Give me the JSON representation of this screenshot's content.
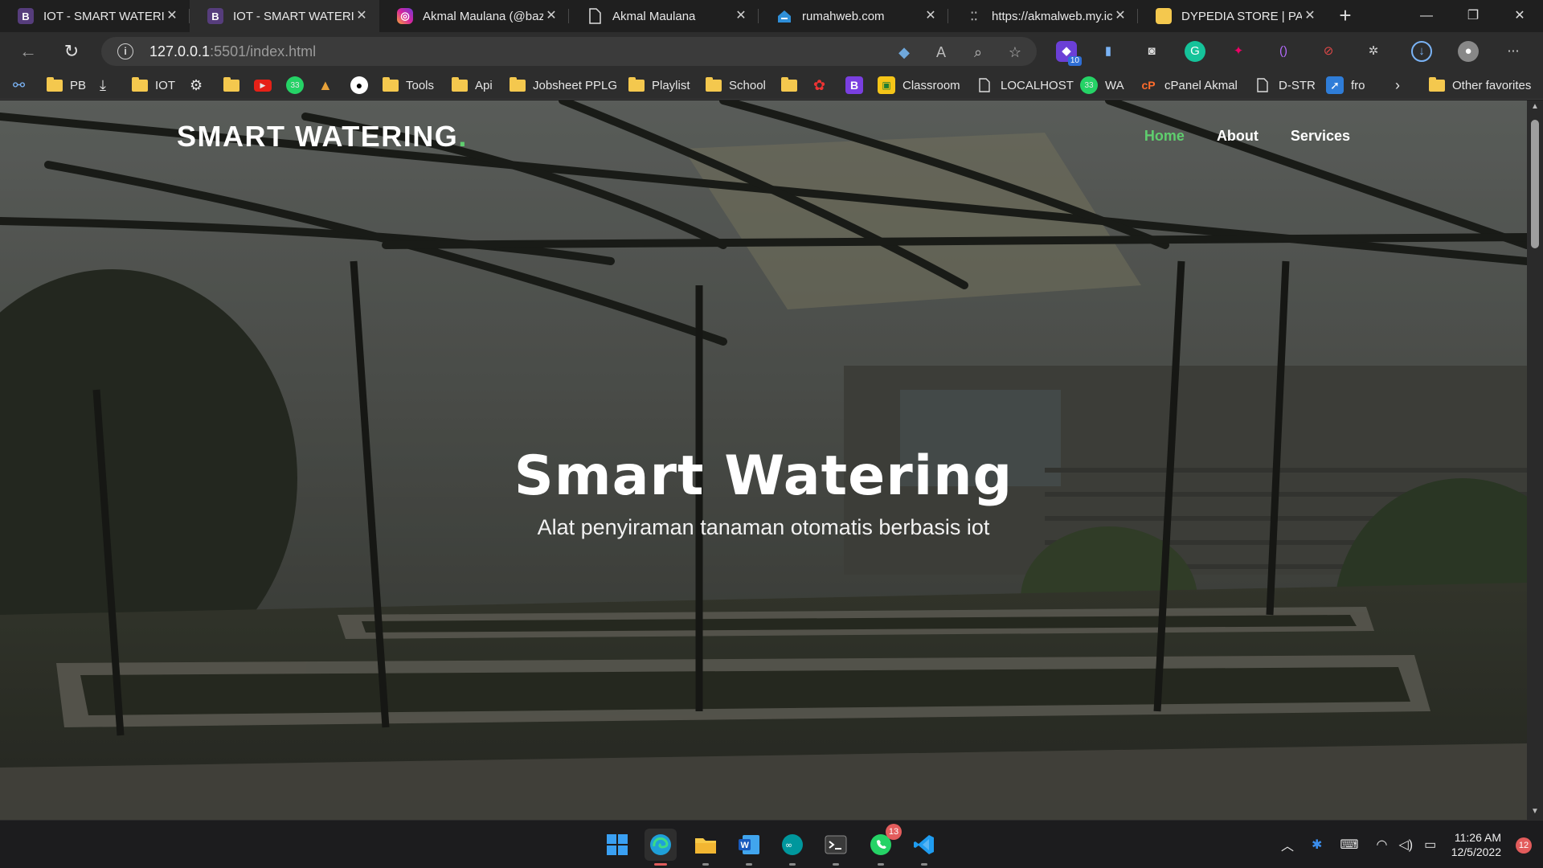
{
  "browser": {
    "tabs": [
      {
        "title": "IOT - SMART WATERIN",
        "favicon": "B",
        "favicon_color": "#563d7c",
        "active": false
      },
      {
        "title": "IOT - SMART WATERIN",
        "favicon": "B",
        "favicon_color": "#563d7c",
        "active": true
      },
      {
        "title": "Akmal Maulana (@baz",
        "favicon": "instagram-icon",
        "favicon_color": "#d6249f",
        "active": false
      },
      {
        "title": "Akmal Maulana",
        "favicon": "page-icon",
        "favicon_color": "#5a5a5a",
        "active": false
      },
      {
        "title": "rumahweb.com",
        "favicon": "rumahweb-icon",
        "favicon_color": "#2f8fd8",
        "active": false
      },
      {
        "title": "https://akmalweb.my.ic",
        "favicon": "loading-icon",
        "favicon_color": "#8a8a8a",
        "active": false
      },
      {
        "title": "DYPEDIA STORE | PANE",
        "favicon": "folder-icon",
        "favicon_color": "#f4c84e",
        "active": false
      }
    ],
    "address": {
      "host": "127.0.0.1",
      "path": ":5501/index.html"
    },
    "extension_badge": "10",
    "bookmarks": [
      {
        "label": "PB",
        "icon": "folder"
      },
      {
        "label": "IOT",
        "icon": "folder"
      },
      {
        "label": "Tools",
        "icon": "folder"
      },
      {
        "label": "Api",
        "icon": "folder"
      },
      {
        "label": "Jobsheet PPLG",
        "icon": "folder"
      },
      {
        "label": "Playlist",
        "icon": "folder"
      },
      {
        "label": "School",
        "icon": "folder"
      },
      {
        "label": "Classroom",
        "icon": "classroom-icon"
      },
      {
        "label": "LOCALHOST",
        "icon": "page-icon"
      },
      {
        "label": "WA",
        "icon": "whatsapp-icon"
      },
      {
        "label": "cPanel Akmal",
        "icon": "cpanel-icon"
      },
      {
        "label": "D-STR",
        "icon": "page-icon"
      },
      {
        "label": "fro",
        "icon": "app-icon"
      },
      {
        "label": "Other favorites",
        "icon": "folder"
      }
    ],
    "whatsapp_badge_bookmark": "33"
  },
  "page": {
    "brand": "SMART WATERING",
    "brand_dot": ".",
    "nav": [
      {
        "label": "Home",
        "active": true
      },
      {
        "label": "About",
        "active": false
      },
      {
        "label": "Services",
        "active": false
      }
    ],
    "hero_title": "Smart Watering",
    "hero_subtitle": "Alat penyiraman tanaman otomatis berbasis iot",
    "accent_color": "#5fce6e"
  },
  "taskbar": {
    "apps": [
      "windows-start-icon",
      "edge-icon",
      "file-explorer-icon",
      "word-icon",
      "arduino-icon",
      "terminal-icon",
      "whatsapp-icon",
      "vscode-icon"
    ],
    "whatsapp_badge": "13",
    "time": "11:26 AM",
    "date": "12/5/2022",
    "notifications": "12"
  }
}
